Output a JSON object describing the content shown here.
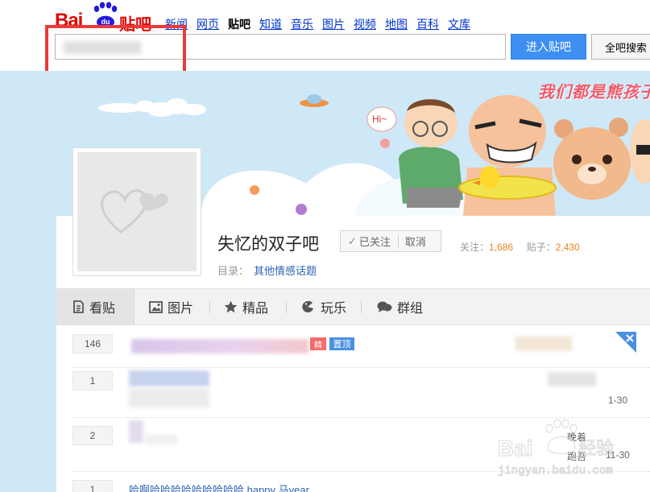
{
  "header": {
    "logo_text_left": "Bai",
    "logo_paw_text": "du",
    "logo_text_right": "贴吧",
    "nav": [
      {
        "label": "新闻",
        "active": false
      },
      {
        "label": "网页",
        "active": false
      },
      {
        "label": "贴吧",
        "active": true
      },
      {
        "label": "知道",
        "active": false
      },
      {
        "label": "音乐",
        "active": false
      },
      {
        "label": "图片",
        "active": false
      },
      {
        "label": "视频",
        "active": false
      },
      {
        "label": "地图",
        "active": false
      },
      {
        "label": "百科",
        "active": false
      },
      {
        "label": "文库",
        "active": false
      }
    ],
    "search_value": "",
    "enter_button": "进入贴吧",
    "all_search_button": "全吧搜索"
  },
  "banner": {
    "slogan": "我们都是熊孩子",
    "speech_bubble": "Hi~"
  },
  "forum": {
    "name": "失忆的双子吧",
    "followed_label": "已关注",
    "cancel_label": "取消",
    "follow_label": "关注：",
    "follow_count": "1,686",
    "posts_label": "贴子：",
    "posts_count": "2,430",
    "catalog_label": "目录：",
    "catalog_value": "其他情感话题"
  },
  "tabs": [
    {
      "label": "看贴",
      "icon": "document-icon",
      "active": true
    },
    {
      "label": "图片",
      "icon": "image-icon",
      "active": false
    },
    {
      "label": "精品",
      "icon": "star-icon",
      "active": false
    },
    {
      "label": "玩乐",
      "icon": "pacman-icon",
      "active": false
    },
    {
      "label": "群组",
      "icon": "chat-icon",
      "active": false
    }
  ],
  "threads": [
    {
      "replies": "146",
      "badge_red": "精",
      "badge_top": "置顶",
      "meta": ""
    },
    {
      "replies": "1",
      "meta": "1-30"
    },
    {
      "replies": "2",
      "meta_a": "晚着",
      "meta_b": "跑吾",
      "meta": "11-30"
    },
    {
      "replies": "1",
      "title": "哈啊哈哈哈哈哈哈哈哈哈 happy 马year"
    }
  ],
  "colors": {
    "brand_red": "#e10601",
    "link_blue": "#2d64b3",
    "button_blue": "#3d8ff2",
    "sky": "#cfe8f7",
    "highlight": "#ec3a3a",
    "count_orange": "#f0821e"
  }
}
